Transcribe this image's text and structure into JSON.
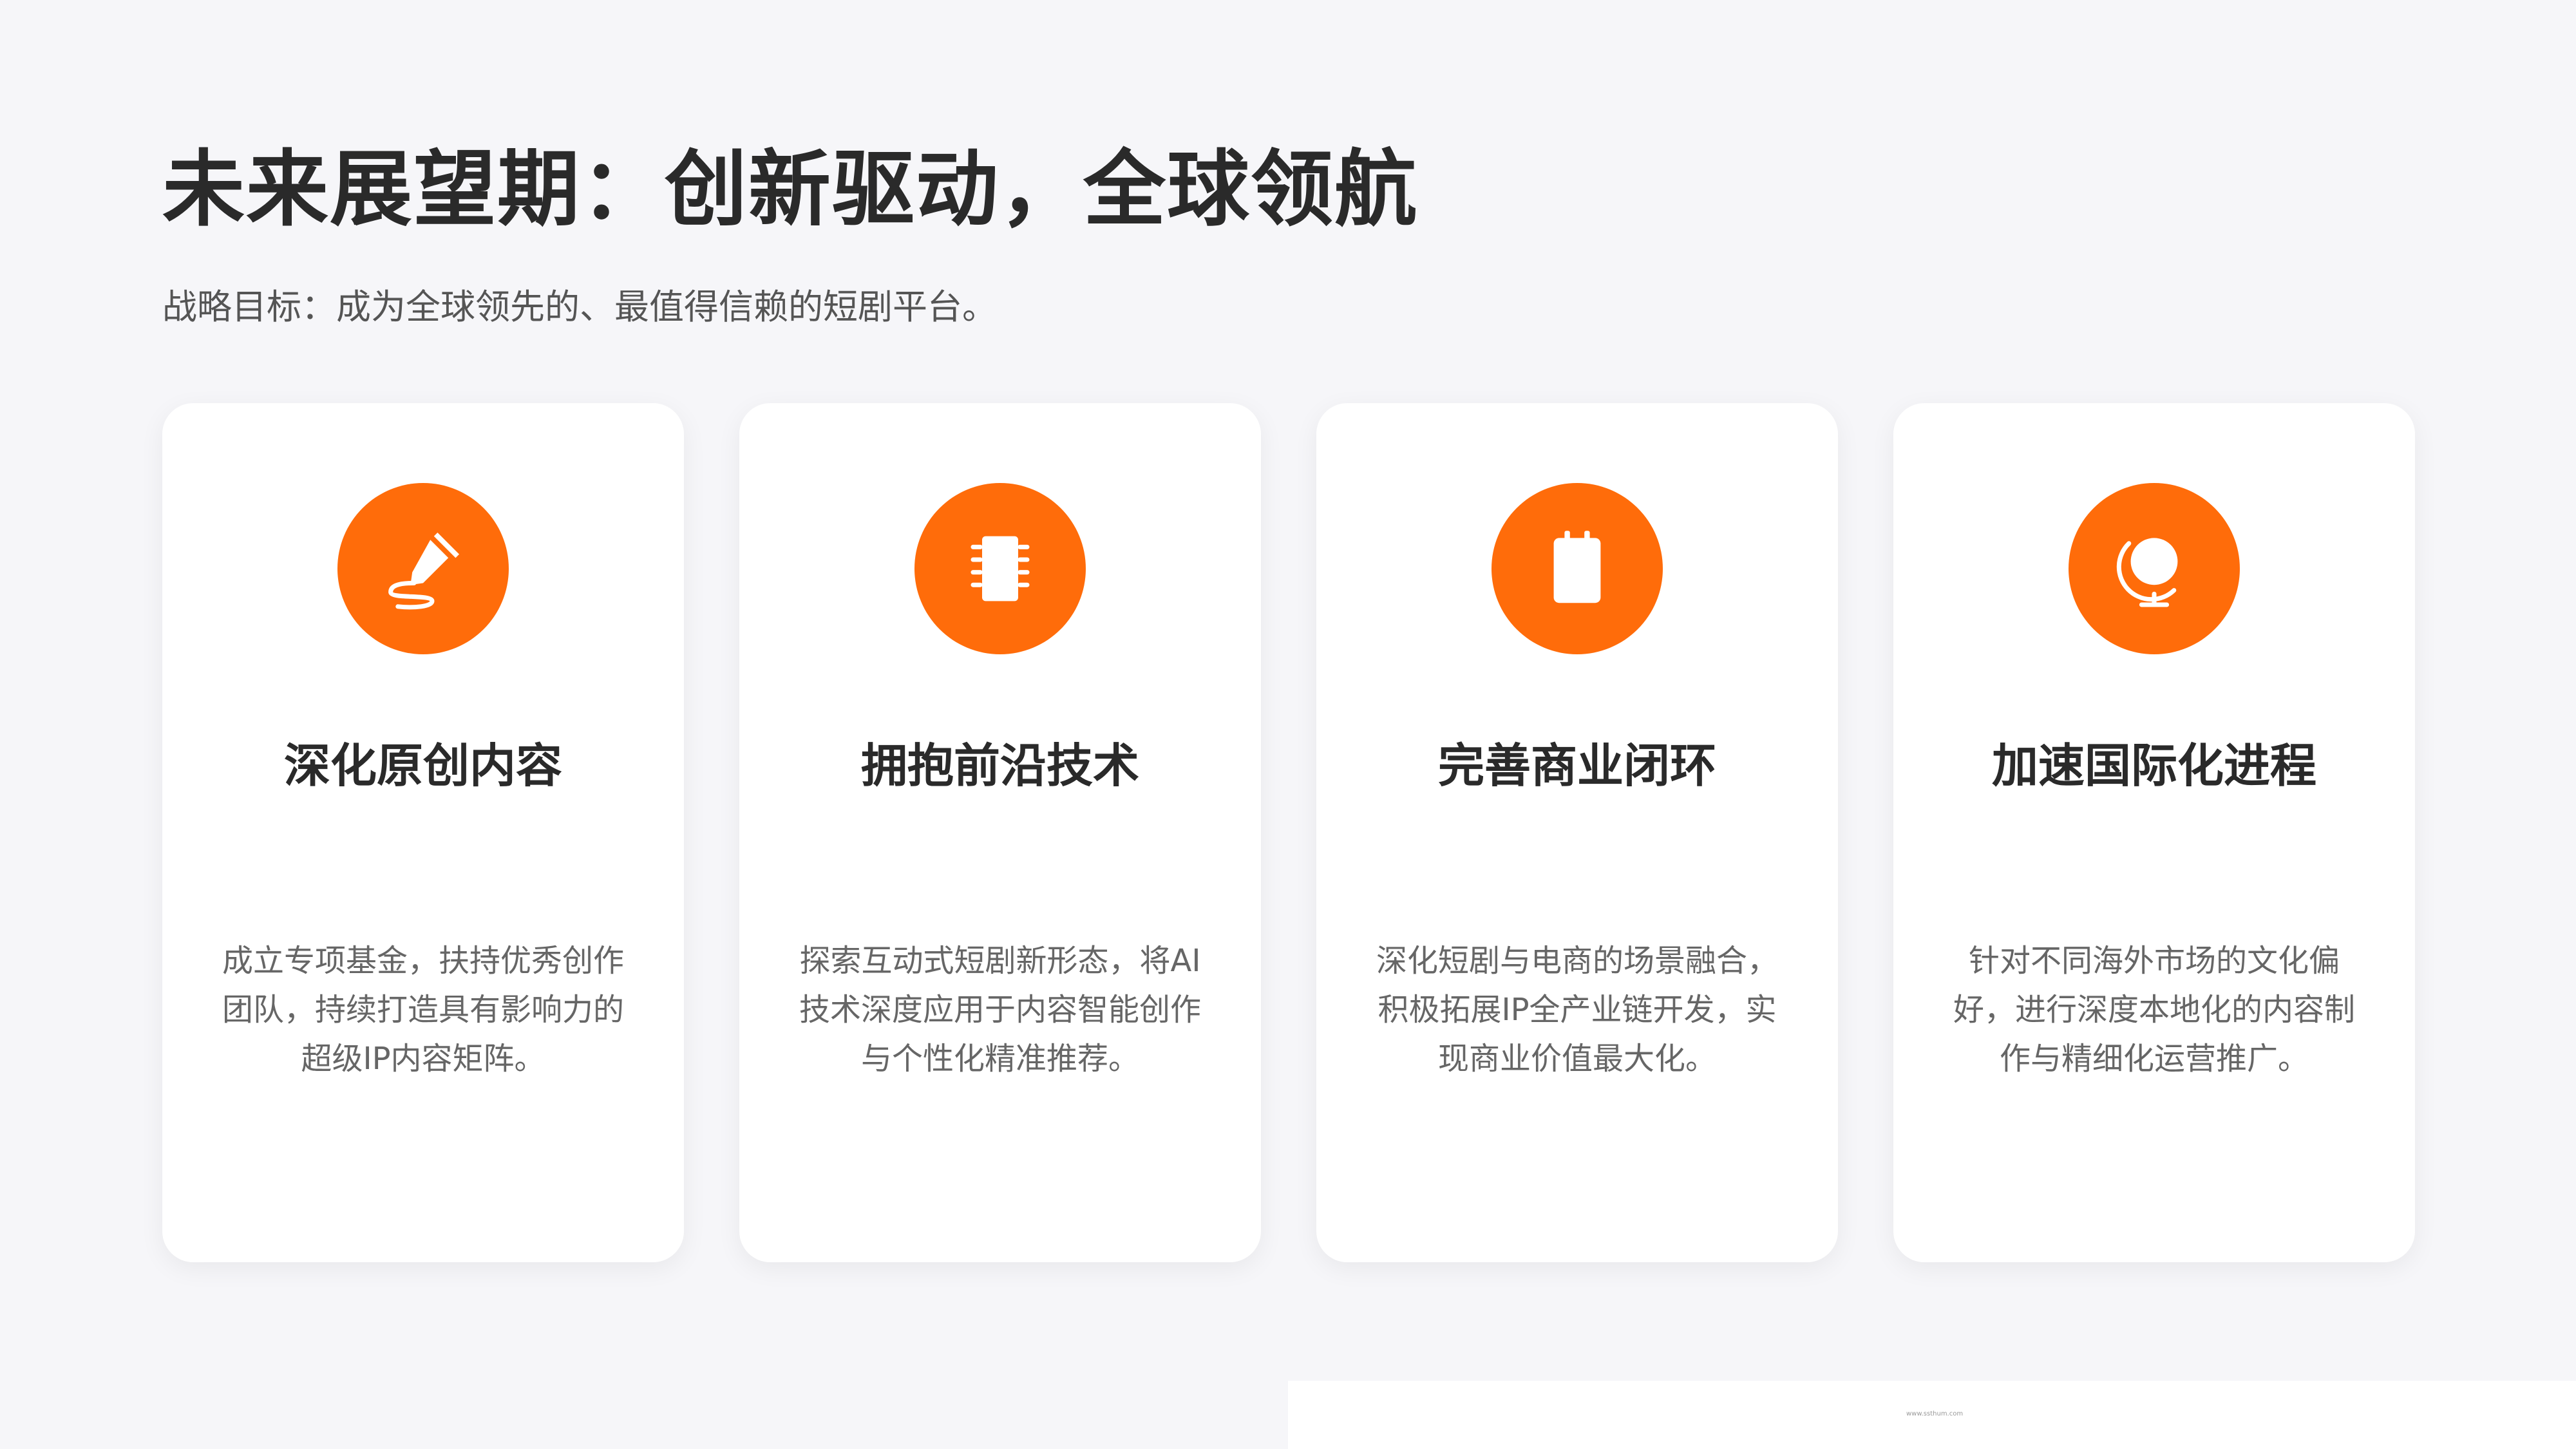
{
  "header": {
    "title": "未来展望期：创新驱动，全球领航",
    "subtitle": "战略目标：成为全球领先的、最值得信赖的短剧平台。"
  },
  "cards": [
    {
      "icon": "pen-icon",
      "title": "深化原创内容",
      "desc": "成立专项基金，扶持优秀创作团队，持续打造具有影响力的超级IP内容矩阵。"
    },
    {
      "icon": "chip-icon",
      "title": "拥抱前沿技术",
      "desc": "探索互动式短剧新形态，将AI技术深度应用于内容智能创作与个性化精准推荐。"
    },
    {
      "icon": "clipboard-icon",
      "title": "完善商业闭环",
      "desc": "深化短剧与电商的场景融合，积极拓展IP全产业链开发，实现商业价值最大化。"
    },
    {
      "icon": "globe-icon",
      "title": "加速国际化进程",
      "desc": "针对不同海外市场的文化偏好，进行深度本地化的内容制作与精细化运营推广。"
    }
  ],
  "footer": {
    "url": "www.ssthum.com"
  },
  "colors": {
    "accent": "#ff6c0a",
    "background": "#f6f6f9",
    "card": "#ffffff"
  }
}
